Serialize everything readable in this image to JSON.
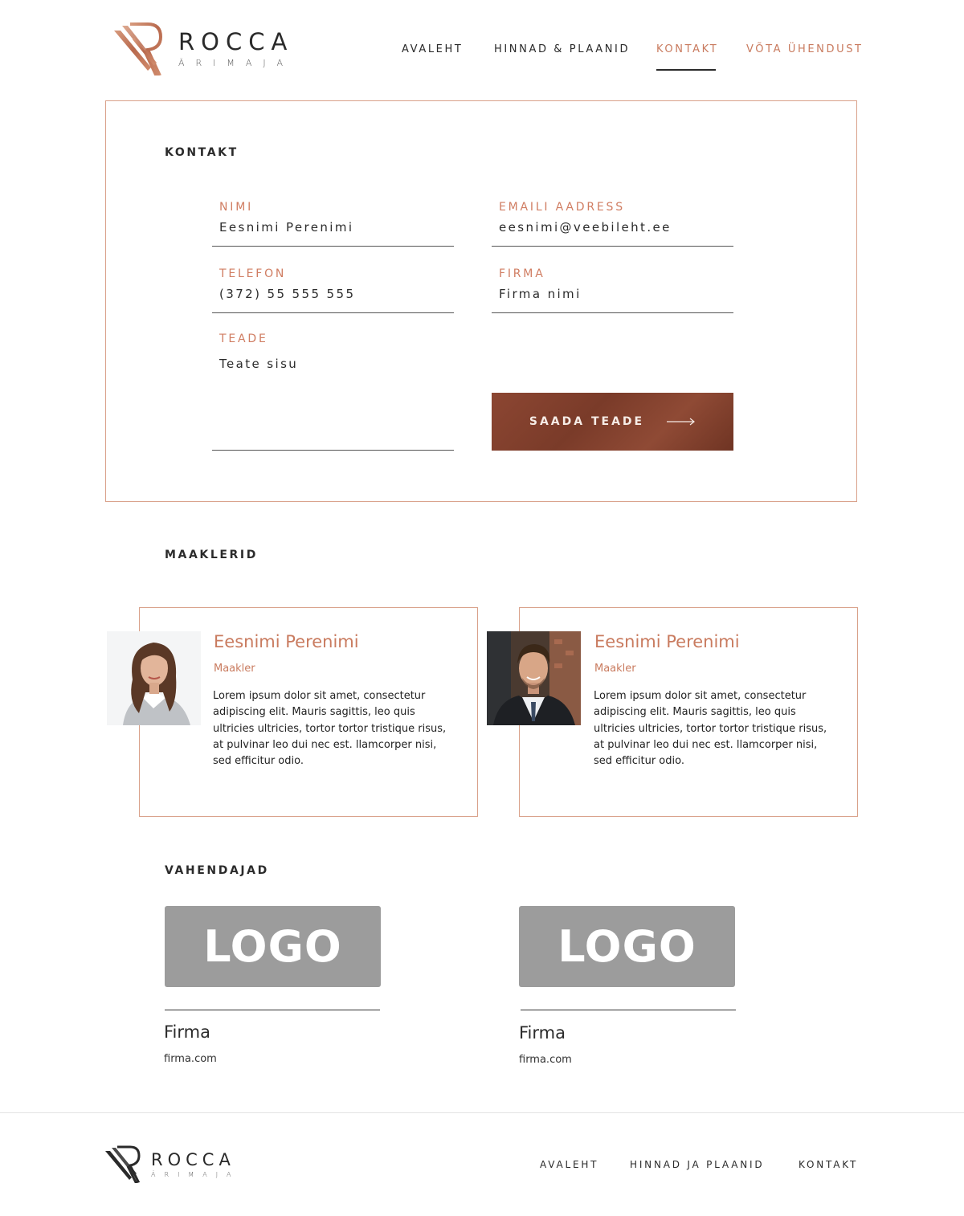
{
  "brand": {
    "title": "ROCCA",
    "subtitle": "ÄRIMAJA",
    "accent_color": "#c97b5f",
    "logo_icon": "rocca-r-logo-icon"
  },
  "nav": {
    "items": [
      {
        "label": "AVALEHT"
      },
      {
        "label": "HINNAD & PLAANID"
      },
      {
        "label": "KONTAKT",
        "active": true
      },
      {
        "label": "VÕTA ÜHENDUST"
      }
    ]
  },
  "contact": {
    "title": "KONTAKT",
    "fields": {
      "name": {
        "label": "NIMI",
        "value": "Eesnimi Perenimi"
      },
      "email": {
        "label": "EMAILI AADRESS",
        "value": "eesnimi@veebileht.ee"
      },
      "phone": {
        "label": "TELEFON",
        "value": "(372) 55 555 555"
      },
      "company": {
        "label": "FIRMA",
        "value": "Firma nimi"
      },
      "message": {
        "label": "TEADE",
        "value": "Teate sisu"
      }
    },
    "submit_label": "SAADA TEADE"
  },
  "brokers": {
    "title": "MAAKLERID",
    "items": [
      {
        "name": "Eesnimi Perenimi",
        "role": "Maakler",
        "bio": "Lorem ipsum dolor sit amet, consectetur adipiscing elit. Mauris sagittis, leo quis ultricies ultricies, tortor tortor tristique risus, at pulvinar leo dui nec est. llamcorper nisi, sed efficitur odio.",
        "photo": "woman-portrait"
      },
      {
        "name": "Eesnimi Perenimi",
        "role": "Maakler",
        "bio": "Lorem ipsum dolor sit amet, consectetur adipiscing elit. Mauris sagittis, leo quis ultricies ultricies, tortor tortor tristique risus, at pulvinar leo dui nec est. llamcorper nisi, sed efficitur odio.",
        "photo": "man-portrait"
      }
    ]
  },
  "partners": {
    "title": "VAHENDAJAD",
    "items": [
      {
        "logo_text": "LOGO",
        "name": "Firma",
        "url": "firma.com"
      },
      {
        "logo_text": "LOGO",
        "name": "Firma",
        "url": "firma.com"
      }
    ]
  },
  "footer": {
    "nav": [
      {
        "label": "AVALEHT"
      },
      {
        "label": "HINNAD JA PLAANID"
      },
      {
        "label": "KONTAKT"
      }
    ]
  }
}
